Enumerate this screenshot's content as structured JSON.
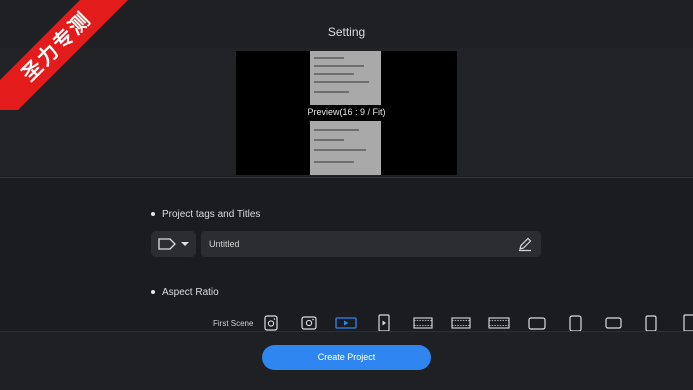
{
  "header": {
    "title": "Setting"
  },
  "watermark": {
    "text": "圣力专测",
    "color": "#e31b1b"
  },
  "preview": {
    "label": "Preview(16 : 9 / Fit)"
  },
  "project": {
    "section_title": "Project tags and Titles",
    "name_value": "Untitled"
  },
  "aspect": {
    "section_title": "Aspect Ratio",
    "first_scene_label": "First Scene",
    "icons": [
      "instagram-square",
      "instagram-landscape",
      "youtube-16-9",
      "youtube-vertical",
      "film-wide",
      "film-cinema",
      "film-panorama",
      "rect-landscape",
      "rect-portrait",
      "rect-square",
      "rect-tall",
      "rect-partial"
    ],
    "selected_icon": "youtube-16-9"
  },
  "footer": {
    "create_label": "Create Project"
  },
  "colors": {
    "accent": "#2f86f0",
    "background": "#1b1c20"
  }
}
